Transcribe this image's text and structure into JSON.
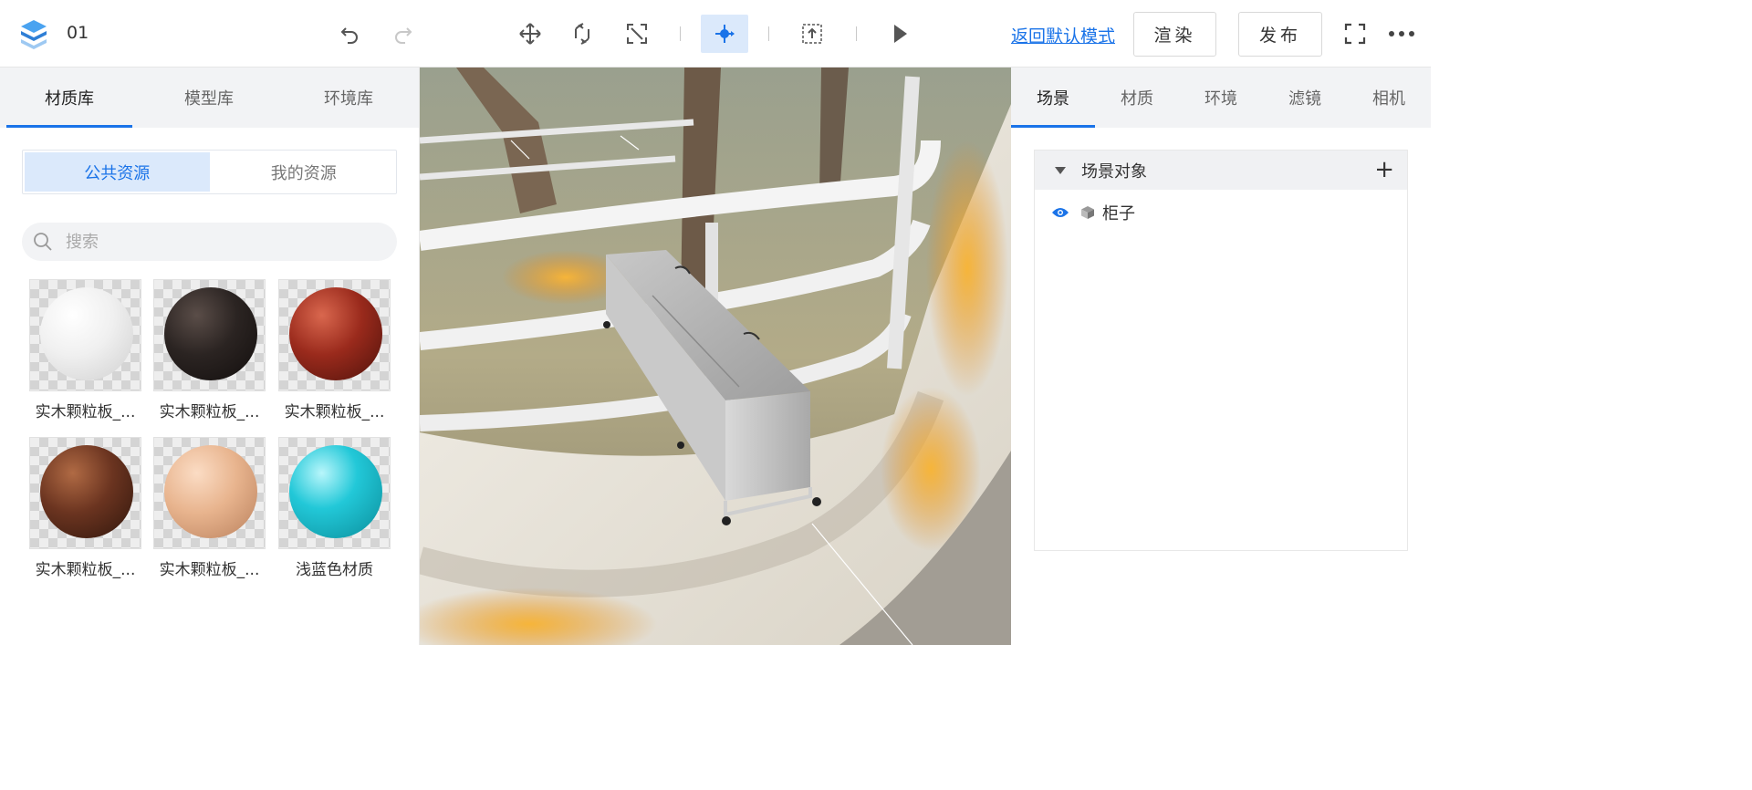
{
  "header": {
    "project_name": "01",
    "return_default_mode": "返回默认模式",
    "render_label": "渲染",
    "publish_label": "发布"
  },
  "left_panel": {
    "tabs": [
      {
        "label": "材质库",
        "active": true
      },
      {
        "label": "模型库",
        "active": false
      },
      {
        "label": "环境库",
        "active": false
      }
    ],
    "resource_tabs": [
      {
        "label": "公共资源",
        "active": true
      },
      {
        "label": "我的资源",
        "active": false
      }
    ],
    "search": {
      "placeholder": "搜索",
      "value": ""
    },
    "materials": [
      {
        "label": "实木颗粒板_...",
        "color": "#f2f2f2"
      },
      {
        "label": "实木颗粒板_...",
        "color": "#2b2422"
      },
      {
        "label": "实木颗粒板_...",
        "color": "#9a2a1c"
      },
      {
        "label": "实木颗粒板_...",
        "color": "#6b3420"
      },
      {
        "label": "实木颗粒板_...",
        "color": "#e8b48e"
      },
      {
        "label": "浅蓝色材质",
        "color": "#22c8d8"
      }
    ]
  },
  "right_panel": {
    "tabs": [
      {
        "label": "场景",
        "active": true
      },
      {
        "label": "材质",
        "active": false
      },
      {
        "label": "环境",
        "active": false
      },
      {
        "label": "滤镜",
        "active": false
      },
      {
        "label": "相机",
        "active": false
      }
    ],
    "scene_objects_title": "场景对象",
    "objects": [
      {
        "name": "柜子",
        "visible": true
      }
    ]
  },
  "colors": {
    "accent": "#1a73e8",
    "active_bg": "#dbe9fb",
    "tab_bar_bg": "#f2f3f5"
  }
}
